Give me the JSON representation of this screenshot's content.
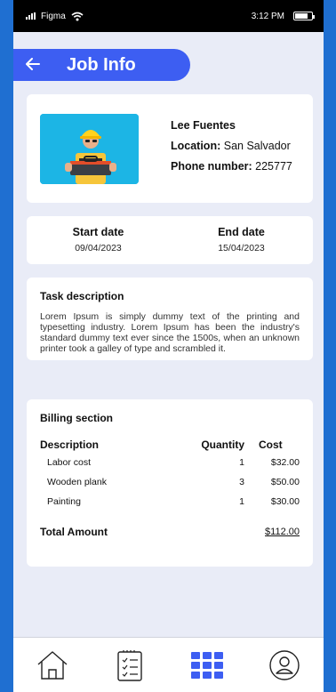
{
  "status_bar": {
    "carrier": "Figma",
    "time": "3:12 PM"
  },
  "header": {
    "back_icon": "arrow-left-icon",
    "title": "Job Info"
  },
  "profile": {
    "name": "Lee Fuentes",
    "location_label": "Location:",
    "location": "San Salvador",
    "phone_label": "Phone number:",
    "phone": "225777"
  },
  "dates": {
    "start_label": "Start date",
    "start": "09/04/2023",
    "end_label": "End date",
    "end": "15/04/2023"
  },
  "task": {
    "title": "Task description",
    "text": "Lorem Ipsum is simply dummy text of the printing and typesetting industry. Lorem Ipsum has been the industry's standard dummy text ever since the 1500s, when an unknown printer took a galley of type and scrambled it."
  },
  "billing": {
    "title": "Billing section",
    "col_description": "Description",
    "col_quantity": "Quantity",
    "col_cost": "Cost",
    "items": [
      {
        "description": "Labor cost",
        "quantity": "1",
        "cost": "$32.00"
      },
      {
        "description": "Wooden plank",
        "quantity": "3",
        "cost": "$50.00"
      },
      {
        "description": "Painting",
        "quantity": "1",
        "cost": "$30.00"
      }
    ],
    "total_label": "Total Amount",
    "total": "$112.00"
  },
  "nav": {
    "items": [
      "home-icon",
      "clipboard-list-icon",
      "grid-icon",
      "user-icon"
    ],
    "active_color": "#3d5ef2"
  },
  "colors": {
    "accent": "#3d5ef2",
    "background": "#1f6fd1",
    "screen": "#e9ecf7"
  }
}
